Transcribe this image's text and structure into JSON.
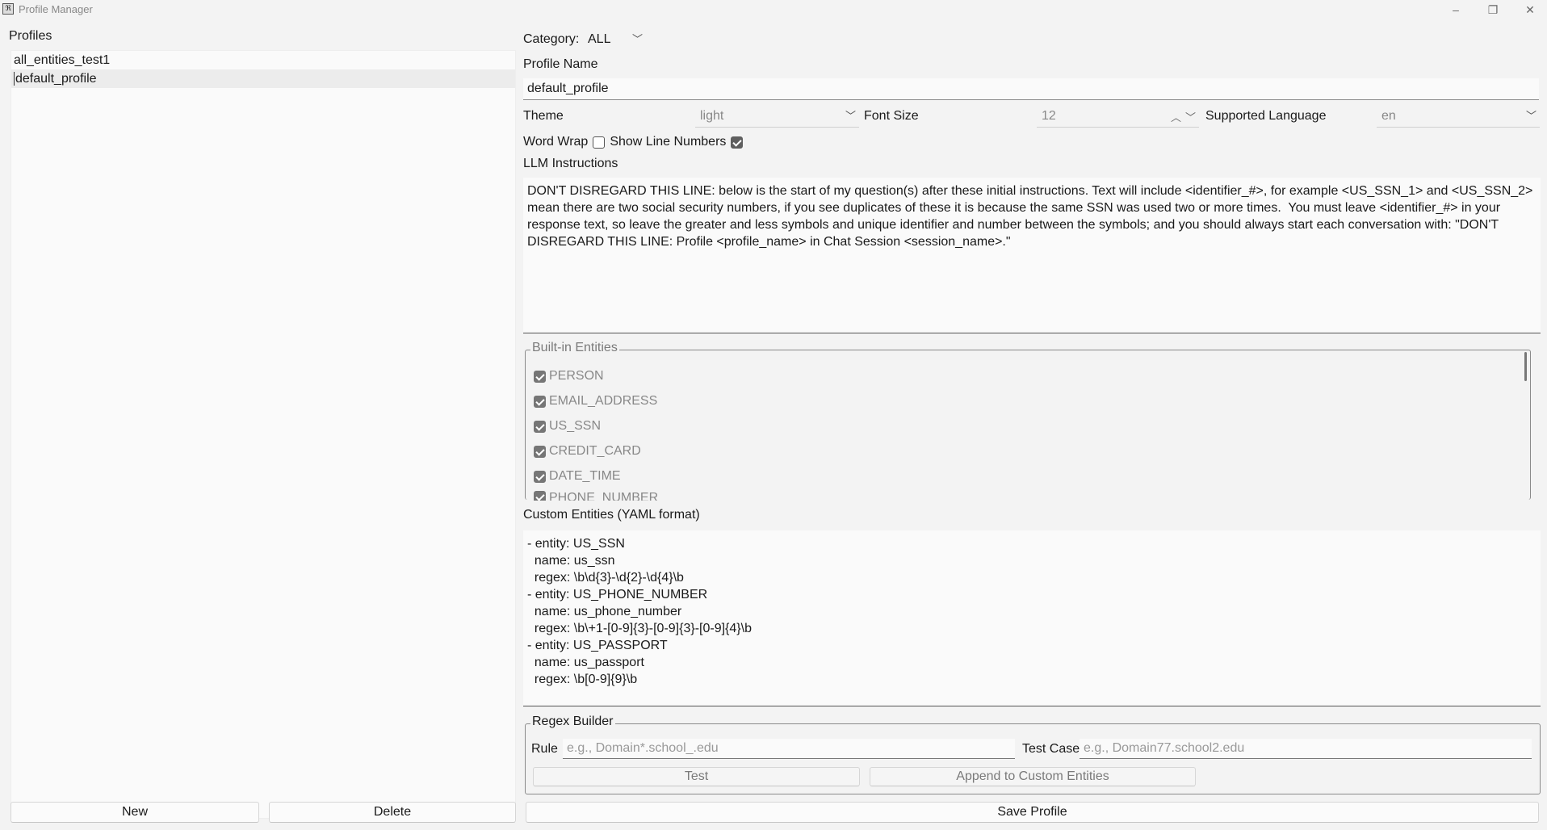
{
  "window": {
    "title": "Profile Manager",
    "icon": "app-icon",
    "controls": {
      "minimize": "–",
      "maximize": "❐",
      "close": "✕"
    }
  },
  "profiles": {
    "label": "Profiles",
    "items": [
      "all_entities_test1",
      "default_profile"
    ],
    "selected": "default_profile"
  },
  "buttons": {
    "new": "New",
    "delete": "Delete",
    "save": "Save Profile",
    "test": "Test",
    "append": "Append to Custom Entities"
  },
  "category": {
    "label": "Category:",
    "value": "ALL"
  },
  "profile_name": {
    "label": "Profile Name",
    "value": "default_profile"
  },
  "theme": {
    "label": "Theme",
    "value": "light"
  },
  "font_size": {
    "label": "Font Size",
    "value": "12"
  },
  "language": {
    "label": "Supported Language",
    "value": "en"
  },
  "word_wrap": {
    "label": "Word Wrap",
    "checked": false
  },
  "line_numbers": {
    "label": "Show Line Numbers",
    "checked": true
  },
  "llm": {
    "label": "LLM Instructions",
    "text": "DON'T DISREGARD THIS LINE: below is the start of my question(s) after these initial instructions. Text will include <identifier_#>, for example <US_SSN_1> and <US_SSN_2> mean there are two social security numbers, if you see duplicates of these it is because the same SSN was used two or more times.  You must leave <identifier_#> in your response text, so leave the greater and less symbols and unique identifier and number between the symbols; and you should always start each conversation with: \"DON'T DISREGARD THIS LINE: Profile <profile_name> in Chat Session <session_name>.\""
  },
  "builtin": {
    "label": "Built-in Entities",
    "items": [
      "PERSON",
      "EMAIL_ADDRESS",
      "US_SSN",
      "CREDIT_CARD",
      "DATE_TIME",
      "PHONE_NUMBER"
    ]
  },
  "custom": {
    "label": "Custom Entities (YAML format)",
    "text": "- entity: US_SSN\n  name: us_ssn\n  regex: \\b\\d{3}-\\d{2}-\\d{4}\\b\n- entity: US_PHONE_NUMBER\n  name: us_phone_number\n  regex: \\b\\+1-[0-9]{3}-[0-9]{3}-[0-9]{4}\\b\n- entity: US_PASSPORT\n  name: us_passport\n  regex: \\b[0-9]{9}\\b"
  },
  "regex": {
    "label": "Regex Builder",
    "rule_label": "Rule",
    "rule_placeholder": "e.g., Domain*.school_.edu",
    "test_label": "Test Case",
    "test_placeholder": "e.g., Domain77.school2.edu"
  }
}
